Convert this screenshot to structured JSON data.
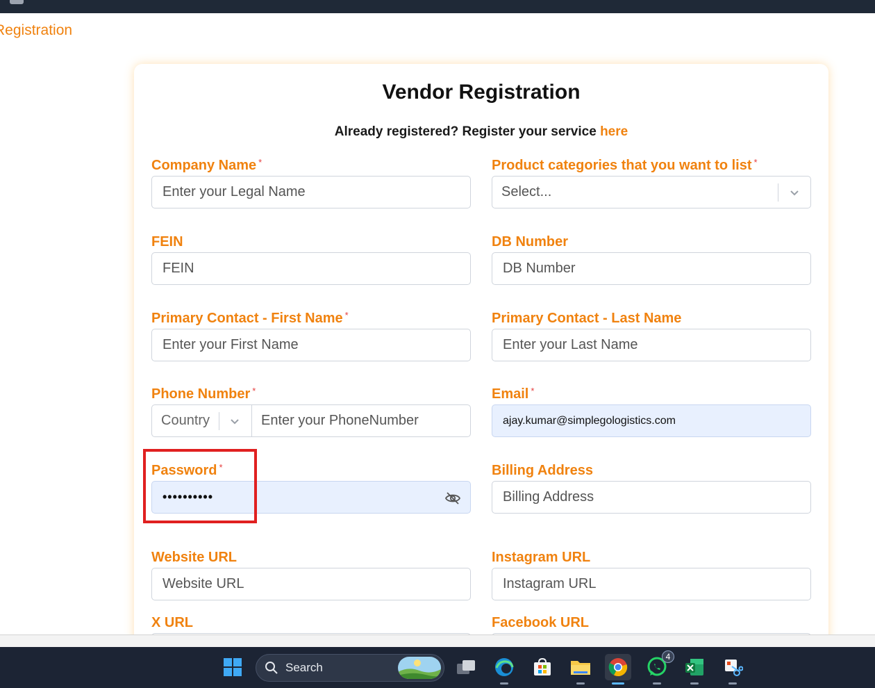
{
  "breadcrumb": "Registration",
  "form": {
    "title": "Vendor Registration",
    "subtitle_text": "Already registered? Register your service",
    "subtitle_link": "here",
    "company_name": {
      "label": "Company Name",
      "placeholder": "Enter your Legal Name"
    },
    "product_categories": {
      "label": "Product categories that you want to list",
      "placeholder": "Select..."
    },
    "fein": {
      "label": "FEIN",
      "placeholder": "FEIN"
    },
    "db_number": {
      "label": "DB Number",
      "placeholder": "DB Number"
    },
    "first_name": {
      "label": "Primary Contact - First Name",
      "placeholder": "Enter your First Name"
    },
    "last_name": {
      "label": "Primary Contact - Last Name",
      "placeholder": "Enter your Last Name"
    },
    "phone": {
      "label": "Phone Number",
      "country_placeholder": "Country",
      "placeholder": "Enter your PhoneNumber"
    },
    "email": {
      "label": "Email",
      "value": "ajay.kumar@simplegologistics.com"
    },
    "password": {
      "label": "Password",
      "value": "••••••••••"
    },
    "billing_address": {
      "label": "Billing Address",
      "placeholder": "Billing Address"
    },
    "website_url": {
      "label": "Website URL",
      "placeholder": "Website URL"
    },
    "instagram_url": {
      "label": "Instagram URL",
      "placeholder": "Instagram URL"
    },
    "x_url": {
      "label": "X URL"
    },
    "facebook_url": {
      "label": "Facebook URL"
    },
    "required_marker": "*"
  },
  "taskbar": {
    "search_label": "Search",
    "whatsapp_badge": "4"
  },
  "colors": {
    "accent": "#f0820f",
    "required": "#e53e3e",
    "highlight": "#e02020",
    "autofill": "#e8f0fe"
  }
}
